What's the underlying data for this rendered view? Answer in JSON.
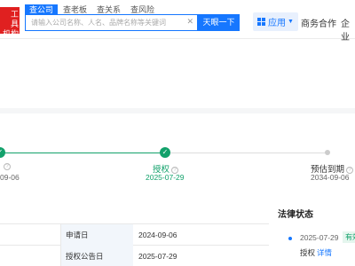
{
  "header": {
    "logo_lines": [
      "工 具",
      "机构"
    ],
    "search_tabs": [
      "查公司",
      "查老板",
      "查关系",
      "查风险"
    ],
    "search_placeholder": "请输入公司名称、人名、品牌名称等关键词",
    "search_button": "天眼一下",
    "nav": {
      "app_label": "应用",
      "business_label": "商务合作",
      "enterprise_label": "企业"
    }
  },
  "timeline": {
    "left_date": "09-06",
    "middle_label": "授权",
    "middle_date": "2025-07-29",
    "right_label": "预估到期",
    "right_date": "2034-09-06"
  },
  "details": {
    "rows": [
      {
        "label": "申请日",
        "value": "2024-09-06"
      },
      {
        "label": "授权公告日",
        "value": "2025-07-29"
      }
    ]
  },
  "legal": {
    "title": "法律状态",
    "event_date": "2025-07-29",
    "badge": "有效",
    "status": "授权",
    "detail_link": "详情"
  },
  "colors": {
    "accent": "#1677ff",
    "success": "#12a16b",
    "brand_red": "#e02020"
  }
}
